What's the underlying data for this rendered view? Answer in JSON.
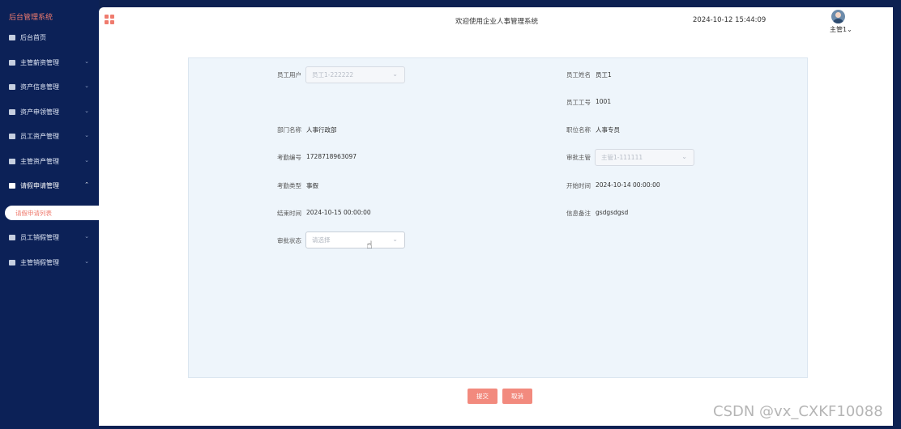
{
  "sidebar": {
    "brand": "后台管理系统",
    "items": [
      {
        "label": "后台首页",
        "has_caret": false
      },
      {
        "label": "主管薪资管理",
        "has_caret": true
      },
      {
        "label": "资产信息管理",
        "has_caret": true
      },
      {
        "label": "资产申领管理",
        "has_caret": true
      },
      {
        "label": "员工资产管理",
        "has_caret": true
      },
      {
        "label": "主管资产管理",
        "has_caret": true
      },
      {
        "label": "请假申请管理",
        "has_caret": true,
        "expanded": true
      },
      {
        "label": "员工销假管理",
        "has_caret": true
      },
      {
        "label": "主管销假管理",
        "has_caret": true
      }
    ],
    "active_sub": "请假申请列表",
    "caret_down": "⌄",
    "caret_up": "⌃"
  },
  "header": {
    "welcome": "欢迎使用企业人事管理系统",
    "datetime": "2024-10-12 15:44:09",
    "user": "主管1",
    "user_caret": "⌄"
  },
  "form": {
    "employee_user_label": "员工用户",
    "employee_user_value": "员工1-222222",
    "employee_name_label": "员工姓名",
    "employee_name_value": "员工1",
    "employee_id_label": "员工工号",
    "employee_id_value": "1001",
    "dept_label": "部门名称",
    "dept_value": "人事行政部",
    "position_label": "职位名称",
    "position_value": "人事专员",
    "attendance_no_label": "考勤编号",
    "attendance_no_value": "1728718963097",
    "approver_label": "审批主管",
    "approver_value": "主管1-111111",
    "attendance_type_label": "考勤类型",
    "attendance_type_value": "事假",
    "start_label": "开始时间",
    "start_value": "2024-10-14 00:00:00",
    "end_label": "结束时间",
    "end_value": "2024-10-15 00:00:00",
    "note_label": "信息备注",
    "note_value": "gsdgsdgsd",
    "status_label": "审批状态",
    "status_placeholder": "请选择",
    "select_arrow": "⌄"
  },
  "buttons": {
    "submit": "提交",
    "cancel": "取消"
  },
  "cursor_glyph": "☝",
  "watermark": "CSDN @vx_CXKF10088",
  "colors": {
    "sidebar_bg": "#0c2157",
    "accent": "#ef7b6e",
    "button": "#f28a7e",
    "form_bg": "#eef5fb"
  }
}
